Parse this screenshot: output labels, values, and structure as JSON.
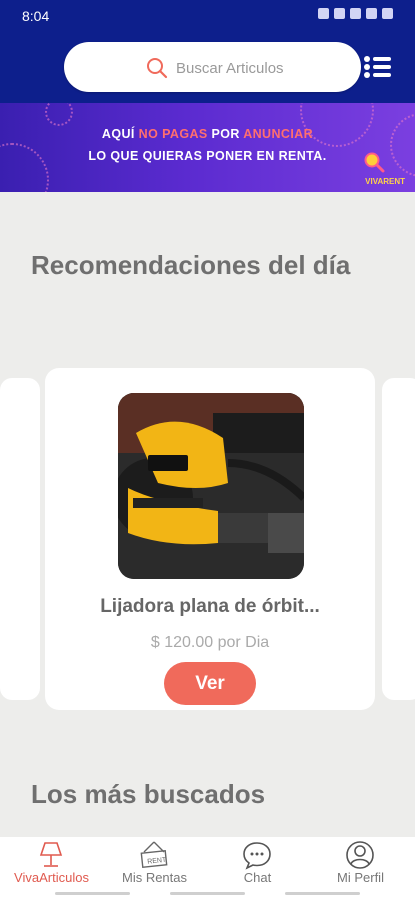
{
  "status_bar": {
    "time": "8:04"
  },
  "search": {
    "placeholder": "Buscar Articulos"
  },
  "banner": {
    "line1_a": "AQUÍ ",
    "line1_b": "NO PAGAS",
    "line1_c": " POR ",
    "line1_d": "ANUNCIAR",
    "line2_a": "LO QUE QUIERAS PONER ",
    "line2_b": "EN RENTA.",
    "brand": "VIVARENT"
  },
  "sections": {
    "recommended_title": "Recomendaciones del día",
    "most_searched_title": "Los más buscados"
  },
  "product": {
    "name": "Lijadora plana de órbit...",
    "price": "$ 120.00 por Dia",
    "button_label": "Ver"
  },
  "colors": {
    "header": "#0d1f8c",
    "accent": "#f06a5b"
  },
  "bottom_nav": [
    {
      "label": "VivaArticulos",
      "icon": "lamp-icon",
      "active": true
    },
    {
      "label": "Mis Rentas",
      "icon": "rent-sign-icon",
      "active": false
    },
    {
      "label": "Chat",
      "icon": "chat-bubble-icon",
      "active": false
    },
    {
      "label": "Mi Perfil",
      "icon": "user-profile-icon",
      "active": false
    }
  ]
}
